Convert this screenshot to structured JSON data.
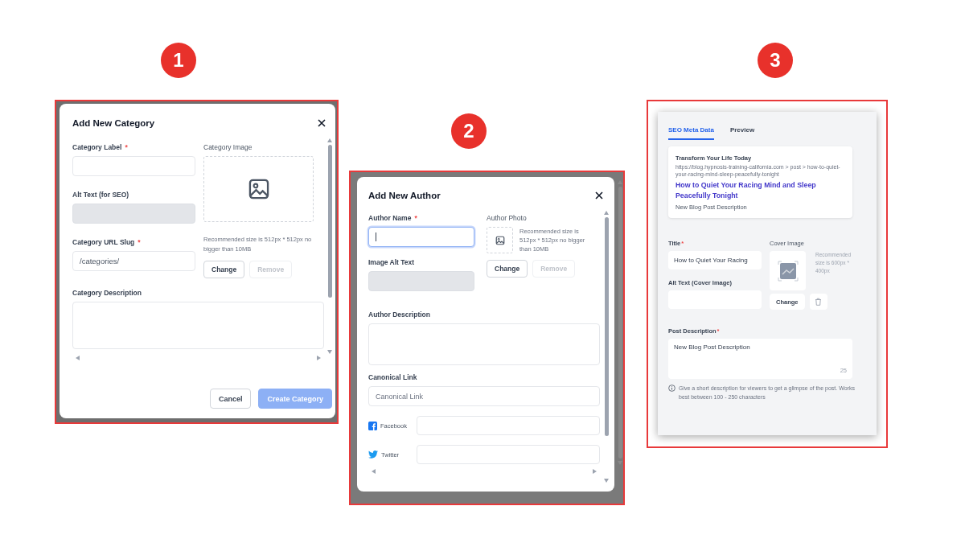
{
  "badges": [
    "1",
    "2",
    "3"
  ],
  "category_dialog": {
    "title": "Add New Category",
    "fields": [
      {
        "label": "Category Label",
        "marker": "*",
        "disabled": false,
        "focused": false
      },
      {
        "label": "Alt Text (for SEO)",
        "disabled": true,
        "focused": false
      },
      {
        "label": "Category URL Slug",
        "marker": "*",
        "value": "/categories/",
        "disabled": false,
        "focused": false
      }
    ],
    "image": {
      "label": "Category Image",
      "hint": "Recommended size is 512px * 512px no bigger than 10MB",
      "buttons": [
        {
          "label": "Change",
          "disabled": false
        },
        {
          "label": "Remove",
          "disabled": true
        }
      ]
    },
    "description": {
      "label": "Category Description"
    },
    "footer": [
      {
        "label": "Cancel",
        "kind": "secondary",
        "disabled": false
      },
      {
        "label": "Create Category",
        "kind": "primary",
        "disabled": true
      }
    ]
  },
  "author_dialog": {
    "title": "Add New Author",
    "fields": [
      {
        "label": "Author Name",
        "marker": "*",
        "disabled": false,
        "focused": true
      },
      {
        "label": "Image Alt Text",
        "disabled": true,
        "focused": false
      }
    ],
    "photo": {
      "label": "Author Photo",
      "hint": "Recommended size is 512px * 512px no bigger than 10MB",
      "buttons": [
        {
          "label": "Change",
          "disabled": false
        },
        {
          "label": "Remove",
          "disabled": true
        }
      ]
    },
    "description": {
      "label": "Author Description"
    },
    "canonical": {
      "label": "Canonical Link",
      "placeholder": "Canonical Link"
    },
    "social": [
      {
        "kind": "facebook",
        "label": "Facebook"
      },
      {
        "kind": "twitter",
        "label": "Twitter"
      }
    ]
  },
  "seo_panel": {
    "tabs": [
      {
        "label": "SEO Meta Data",
        "selected": true
      },
      {
        "label": "Preview",
        "selected": false
      }
    ],
    "preview": {
      "site": "Transform Your Life Today",
      "url": "https://blog.hypnosis-training-california.com > post > how-to-quiet-your-racing-mind-sleep-peacefully-tonight",
      "title": "How to Quiet Your Racing Mind and Sleep Peacefully Tonight",
      "description": "New Blog Post Description"
    },
    "title_field": {
      "label": "Title",
      "marker": "*",
      "value": "How to Quiet Your Racing"
    },
    "alt_field": {
      "label": "Alt Text (Cover Image)"
    },
    "cover": {
      "label": "Cover Image",
      "hint": "Recommended size is 600px * 400px",
      "button": "Change"
    },
    "description": {
      "label": "Post Description",
      "marker": "*",
      "value": "New Blog Post Description",
      "count": "25"
    },
    "help": "Give a short description for viewers to get a glimpse of the post. Works best between 100 - 250 characters"
  }
}
